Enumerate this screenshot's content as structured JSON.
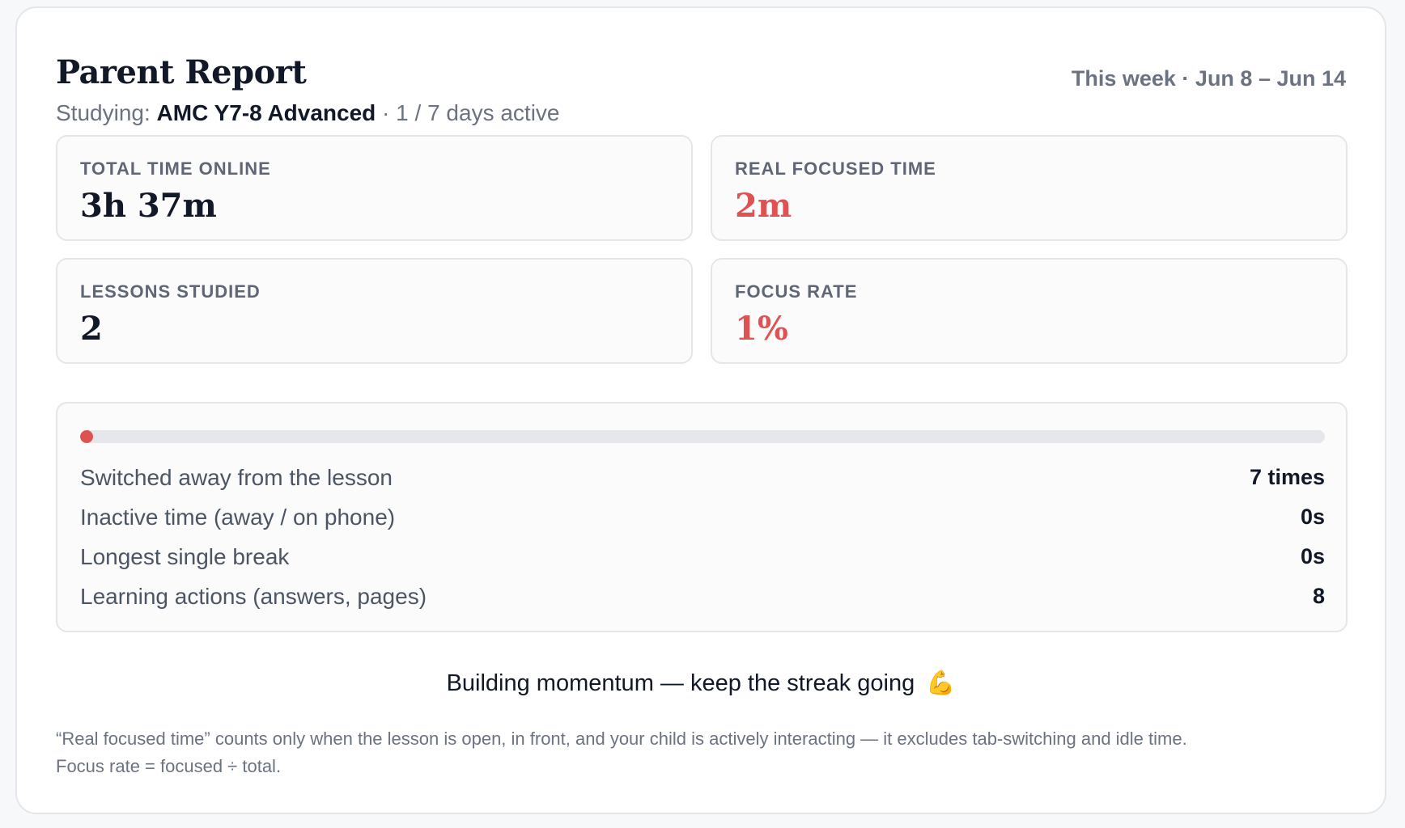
{
  "header": {
    "title": "Parent Report",
    "studying_prefix": "Studying: ",
    "course": "AMC Y7-8 Advanced",
    "days_active": " · 1 / 7 days active",
    "period": "This week · Jun 8 – Jun 14"
  },
  "stats": {
    "total_time": {
      "label": "TOTAL TIME ONLINE",
      "value": "3h 37m"
    },
    "focused_time": {
      "label": "REAL FOCUSED TIME",
      "value": "2m"
    },
    "lessons": {
      "label": "LESSONS STUDIED",
      "value": "2"
    },
    "focus_rate": {
      "label": "FOCUS RATE",
      "value": "1%"
    }
  },
  "focus_bar": {
    "percent": 1,
    "color": "#e05252"
  },
  "details": {
    "rows": [
      {
        "label": "Switched away from the lesson",
        "value": "7 times"
      },
      {
        "label": "Inactive time (away / on phone)",
        "value": "0s"
      },
      {
        "label": "Longest single break",
        "value": "0s"
      },
      {
        "label": "Learning actions (answers, pages)",
        "value": "8"
      }
    ]
  },
  "momentum": {
    "text": "Building momentum — keep the streak going",
    "emoji": "💪"
  },
  "footnote": {
    "line1": "“Real focused time” counts only when the lesson is open, in front, and your child is actively interacting — it excludes tab-switching and idle time.",
    "line2": "Focus rate = focused ÷ total."
  },
  "colors": {
    "alert": "#e05252",
    "text_primary": "#111827",
    "text_muted": "#6b7280",
    "border": "#e4e6ea"
  }
}
